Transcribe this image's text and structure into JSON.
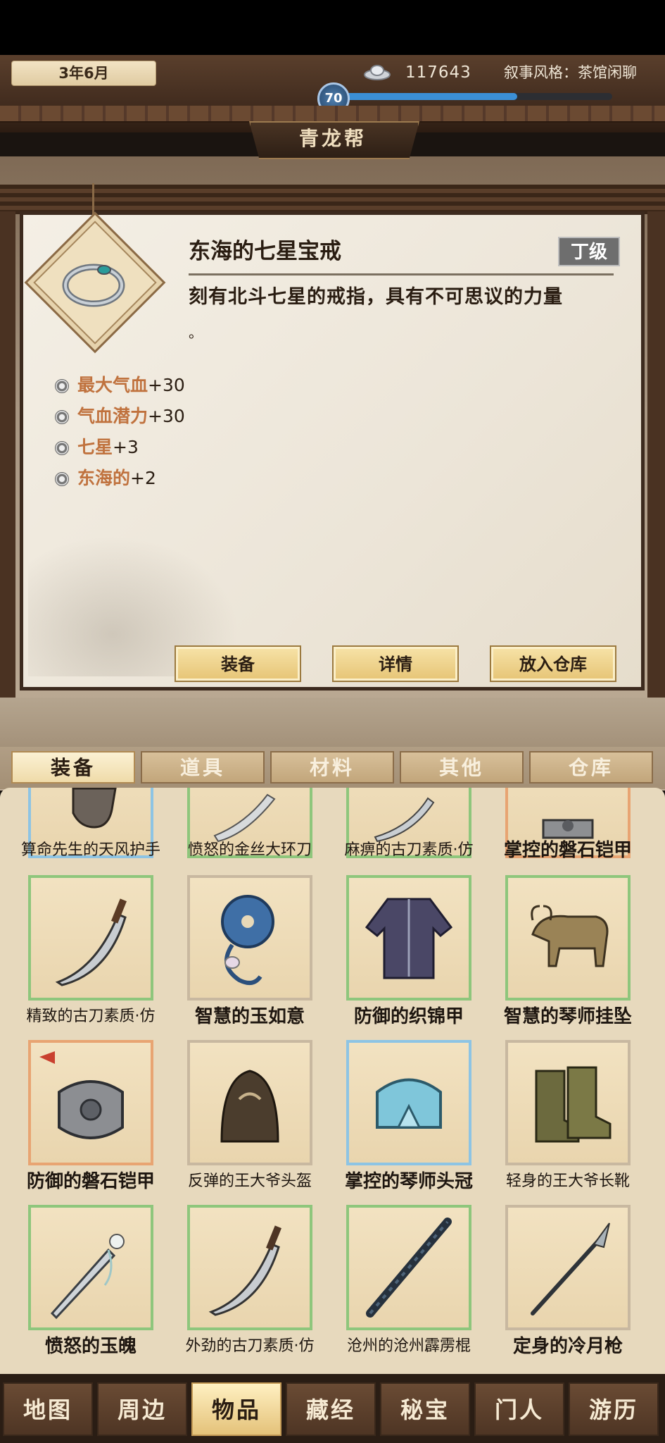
{
  "header": {
    "date": "3年6月",
    "silver_amount": "117643",
    "narrative_style": "叙事风格：茶馆闲聊",
    "level": "70",
    "level_progress": 0.66,
    "gang_name": "青龙帮"
  },
  "detail": {
    "item_name": "东海的七星宝戒",
    "grade": "丁级",
    "description": "刻有北斗七星的戒指，具有不可思议的力量",
    "description_tail": "。",
    "stats": [
      {
        "name": "最大气血",
        "value": "+30"
      },
      {
        "name": "气血潜力",
        "value": "+30"
      },
      {
        "name": "七星",
        "value": "+3"
      },
      {
        "name": "东海的",
        "value": "+2"
      }
    ],
    "buttons": {
      "equip": "装备",
      "details": "详情",
      "store": "放入仓库"
    }
  },
  "tabs": [
    "装备",
    "道具",
    "材料",
    "其他",
    "仓库"
  ],
  "active_tab": "装备",
  "grid": {
    "row0": [
      "算命先生的天风护手",
      "愤怒的金丝大环刀",
      "麻痹的古刀素质·仿",
      "掌控的磐石铠甲"
    ],
    "row1": [
      "精致的古刀素质·仿",
      "智慧的玉如意",
      "防御的织锦甲",
      "智慧的琴师挂坠"
    ],
    "row2": [
      "防御的磐石铠甲",
      "反弹的王大爷头盔",
      "掌控的琴师头冠",
      "轻身的王大爷长靴"
    ],
    "row3": [
      "愤怒的玉魄",
      "外劲的古刀素质·仿",
      "沧州的沧州霹雳棍",
      "定身的冷月枪"
    ]
  },
  "nav": [
    "地图",
    "周边",
    "物品",
    "藏经",
    "秘宝",
    "门人",
    "游历"
  ],
  "active_nav": "物品",
  "colors": {
    "accent_orange": "#c0723e",
    "level_blue": "#3b8fd6",
    "border_green": "#8ec67c",
    "border_blue": "#8dc4e4",
    "border_orange": "#e8a472"
  }
}
